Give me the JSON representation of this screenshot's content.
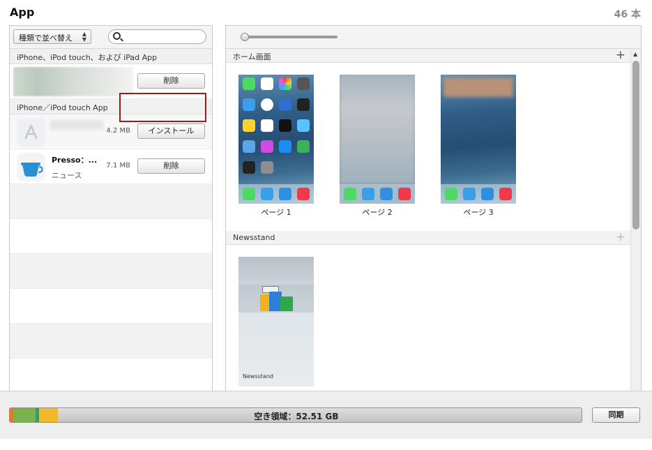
{
  "header": {
    "title": "App",
    "count": "46 本"
  },
  "left": {
    "sort_label": "種類で並べ替え",
    "search_placeholder": "",
    "sections": [
      {
        "label": "iPhone、iPod touch、および iPad App"
      },
      {
        "label": "iPhone／iPod touch App"
      }
    ],
    "rows": [
      {
        "button": "削除"
      },
      {
        "size": "4.2 MB",
        "button": "インストール"
      },
      {
        "name": "Presso：...",
        "category": "ニュース",
        "size": "7.1 MB",
        "button": "削除"
      }
    ]
  },
  "right": {
    "home_label": "ホーム画面",
    "pages": [
      {
        "caption": "ページ 1"
      },
      {
        "caption": "ページ 2"
      },
      {
        "caption": "ページ 3"
      }
    ],
    "newsstand_header": "Newsstand",
    "newsstand_label": "Newsstand"
  },
  "bottom": {
    "free_label": "空き領域：52.51 GB",
    "sync_label": "同期",
    "capacity": [
      {
        "name": "orange",
        "color": "#e07b2a"
      },
      {
        "name": "green",
        "color": "#7ab24b"
      },
      {
        "name": "teal",
        "color": "#2b9b8a"
      },
      {
        "name": "yellow",
        "color": "#f0b92a"
      }
    ]
  }
}
